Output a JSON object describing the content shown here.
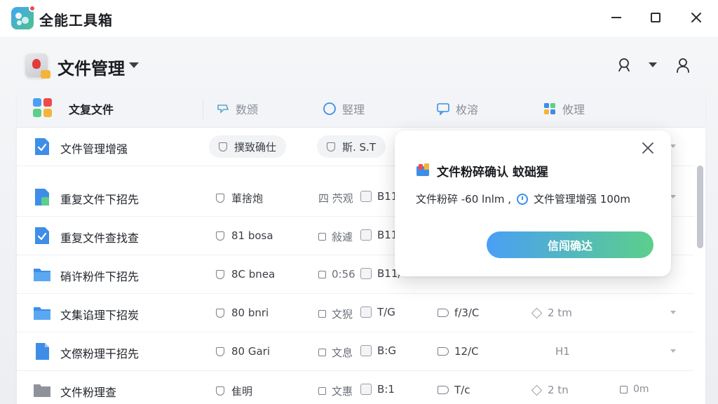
{
  "app": {
    "title": "全能工具箱"
  },
  "header": {
    "title": "文件管理"
  },
  "tabs": [
    {
      "label": "文复文件",
      "active": true
    },
    {
      "label": "数颁"
    },
    {
      "label": "竪理"
    },
    {
      "label": "枚溶"
    },
    {
      "label": "攸理"
    }
  ],
  "rows": [
    {
      "name": "文件管理增强",
      "tag1": "撲致确仕",
      "tag2": "斯. S.T"
    },
    {
      "name": "重复文件下招先",
      "c1": "莗捨炮",
      "c2": "四  茓观",
      "c3": "B11"
    },
    {
      "name": "重复文件查找查",
      "c1": "81 bosa",
      "c2": "敍遽",
      "c3": "B11"
    },
    {
      "name": "硝许粉件下招先",
      "c1": "8C bnea",
      "c2": "0:56",
      "c3": "B11/"
    },
    {
      "name": "文集谄理下招炭",
      "c1": "80 bnri",
      "c2": "文猊",
      "c3": "T/G",
      "c4": "f/3/C",
      "c5": "2 tm"
    },
    {
      "name": "文傺粉理干招先",
      "c1": "80 Gari",
      "c2": "文息",
      "c3": "B:G",
      "c4": "12/C",
      "c6": "H1"
    },
    {
      "name": "文件粉理查",
      "c1": "隹明",
      "c2": "文惠",
      "c3": "B:1",
      "c4": "T/c",
      "c5": "2 tn",
      "c6": "0m"
    }
  ],
  "modal": {
    "title": "文件粉碎确认 蚊础猩",
    "text_left": "文件粉碎 -60 lnlm ,",
    "text_right": "文件管理增强 100m",
    "confirm_label": "信闯确达"
  },
  "colors": {
    "accent_blue": "#4a9ff5",
    "accent_green": "#5ccf8a",
    "folder_blue": "#3e8ee8"
  }
}
